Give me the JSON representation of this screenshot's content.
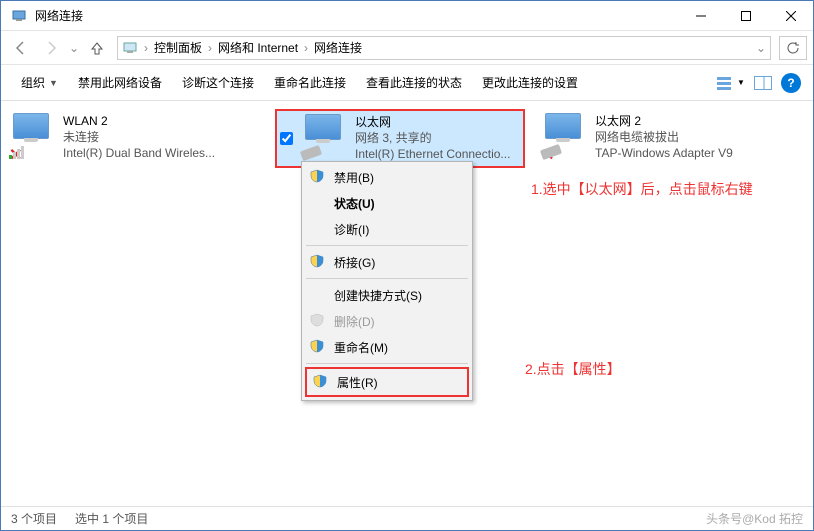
{
  "window": {
    "title": "网络连接"
  },
  "breadcrumbs": {
    "a": "控制面板",
    "b": "网络和 Internet",
    "c": "网络连接"
  },
  "toolbar": {
    "organize": "组织",
    "disable": "禁用此网络设备",
    "diagnose": "诊断这个连接",
    "rename": "重命名此连接",
    "viewstatus": "查看此连接的状态",
    "changesettings": "更改此连接的设置"
  },
  "adapters": [
    {
      "name": "WLAN 2",
      "status": "未连接",
      "device": "Intel(R) Dual Band Wireles..."
    },
    {
      "name": "以太网",
      "status": "网络 3, 共享的",
      "device": "Intel(R) Ethernet Connectio..."
    },
    {
      "name": "以太网 2",
      "status": "网络电缆被拔出",
      "device": "TAP-Windows Adapter V9"
    }
  ],
  "context_menu": {
    "disable": "禁用(B)",
    "status": "状态(U)",
    "diagnose": "诊断(I)",
    "bridge": "桥接(G)",
    "shortcut": "创建快捷方式(S)",
    "delete": "删除(D)",
    "rename": "重命名(M)",
    "properties": "属性(R)"
  },
  "annotations": {
    "a1": "1.选中【以太网】后，点击鼠标右键",
    "a2": "2.点击【属性】"
  },
  "statusbar": {
    "count": "3 个项目",
    "selected": "选中 1 个项目",
    "watermark": "头条号@Kod 拓控"
  }
}
